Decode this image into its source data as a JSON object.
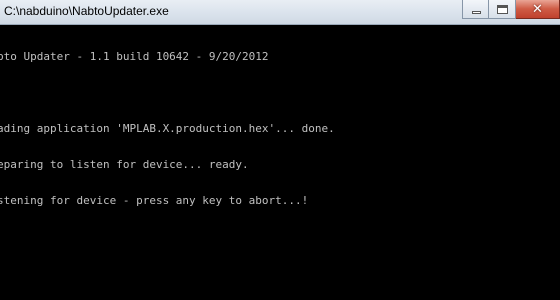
{
  "window": {
    "title": "C:\\nabduino\\NabtoUpdater.exe",
    "close_glyph": "✕"
  },
  "console": {
    "lines": [
      "bto Updater - 1.1 build 10642 - 9/20/2012",
      "",
      "ading application 'MPLAB.X.production.hex'... done.",
      "eparing to listen for device... ready.",
      "stening for device - press any key to abort...!"
    ]
  },
  "colors": {
    "console_background": "#000000",
    "console_text": "#c0c0c0",
    "close_button": "#c8503b"
  },
  "icons": {
    "minimize": "minimize-icon",
    "maximize": "maximize-icon",
    "close": "close-icon"
  }
}
